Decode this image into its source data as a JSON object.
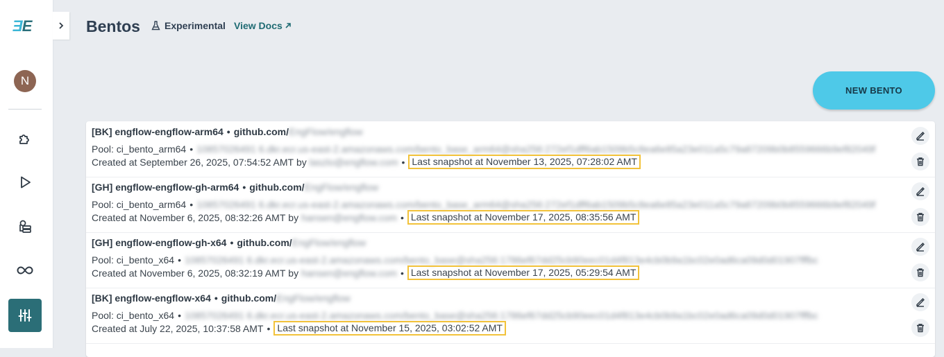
{
  "sidebar": {
    "logo": {
      "part1": "Ǝ",
      "part2": "E"
    },
    "avatar_initial": "N",
    "colors": {
      "active_bg": "#2b6e77",
      "avatar_bg": "#8d6553"
    },
    "nav_icons": [
      "puzzle-icon",
      "play-icon",
      "servers-icon",
      "infinity-icon",
      "sliders-icon"
    ]
  },
  "header": {
    "title": "Bentos",
    "experimental_label": "Experimental",
    "docs_label": "View Docs",
    "new_button_label": "NEW BENTO"
  },
  "bentos": [
    {
      "title": "[BK] engflow-engflow-arm64",
      "repo": "github.com/",
      "repo_blurred": "EngFlow/engflow",
      "pool": "Pool: ci_bento_arm64",
      "image_blurred": "10857026491 6.dkr.ecr.us-east-2.amazonaws.com/bento_base_arm64@sha256:272ef1dff6ab1509b5c8ea6e85a23e011a5c79a87209b0b8559666b9ef82049f",
      "created": "Created at September 26, 2025, 07:54:52 AMT",
      "by_label": "by",
      "creator_blurred": "laszlo@engflow.com",
      "snapshot": "Last snapshot at November 13, 2025, 07:28:02 AMT"
    },
    {
      "title": "[GH] engflow-engflow-gh-arm64",
      "repo": "github.com/",
      "repo_blurred": "EngFlow/engflow",
      "pool": "Pool: ci_bento_arm64",
      "image_blurred": "10857026491 6.dkr.ecr.us-east-2.amazonaws.com/bento_base_arm64@sha256:272ef1dff6ab1509b5c8ea6e85a23e011a5c79a87209b0b8559666b9ef82049f",
      "created": "Created at November 6, 2025, 08:32:26 AMT",
      "by_label": "by",
      "creator_blurred": "hansen@engflow.com",
      "snapshot": "Last snapshot at November 17, 2025, 08:35:56 AMT"
    },
    {
      "title": "[GH] engflow-engflow-gh-x64",
      "repo": "github.com/",
      "repo_blurred": "EngFlow/engflow",
      "pool": "Pool: ci_bento_x64",
      "image_blurred": "10857026491 6.dkr.ecr.us-east-2.amazonaws.com/bento_base@sha256:1786ef67dd25cb90eec01d4f813e4cb0b9a1bc02e0ad6ca09d0d01907fffbc",
      "created": "Created at November 6, 2025, 08:32:19 AMT",
      "by_label": "by",
      "creator_blurred": "hansen@engflow.com",
      "snapshot": "Last snapshot at November 17, 2025, 05:29:54 AMT"
    },
    {
      "title": "[BK] engflow-engflow-x64",
      "repo": "github.com/",
      "repo_blurred": "EngFlow/engflow",
      "pool": "Pool: ci_bento_x64",
      "image_blurred": "10857026491 6.dkr.ecr.us-east-2.amazonaws.com/bento_base@sha256:1786ef67dd25cb90eec01d4f813e4cb0b9a1bc02e0ad6ca09d0d01907fffbc",
      "created": "Created at July 22, 2025, 10:37:58 AMT",
      "snapshot": "Last snapshot at November 15, 2025, 03:02:52 AMT"
    }
  ]
}
